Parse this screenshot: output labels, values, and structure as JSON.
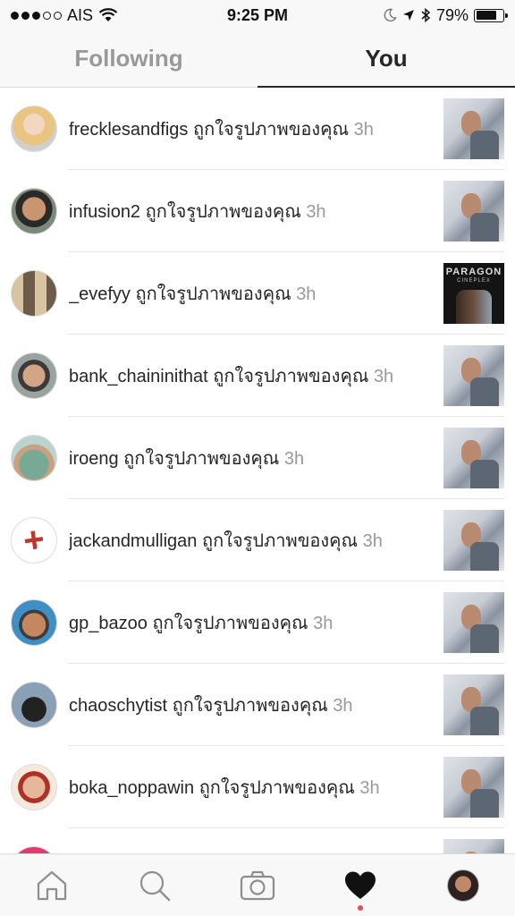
{
  "status_bar": {
    "carrier": "AIS",
    "time": "9:25 PM",
    "battery": "79%",
    "battery_level": 0.79,
    "signal_bars": 3,
    "icons": [
      "wifi-icon",
      "moon-icon",
      "location-arrow-icon",
      "bluetooth-icon",
      "battery-icon"
    ]
  },
  "tabs": [
    {
      "label": "Following",
      "active": false
    },
    {
      "label": "You",
      "active": true
    }
  ],
  "notifications": [
    {
      "username": "frecklesandfigs",
      "action": "ถูกใจรูปภาพของคุณ",
      "time": "3h",
      "thumb": "selfie-photo"
    },
    {
      "username": "infusion2",
      "action": "ถูกใจรูปภาพของคุณ",
      "time": "3h",
      "thumb": "selfie-photo"
    },
    {
      "username": "_evefyy",
      "action": "ถูกใจรูปภาพของคุณ",
      "time": "3h",
      "thumb": "cinema-photo"
    },
    {
      "username": "bank_chaininithat",
      "action": "ถูกใจรูปภาพของคุณ",
      "time": "3h",
      "thumb": "selfie-photo"
    },
    {
      "username": "iroeng",
      "action": "ถูกใจรูปภาพของคุณ",
      "time": "3h",
      "thumb": "selfie-photo"
    },
    {
      "username": "jackandmulligan",
      "action": "ถูกใจรูปภาพของคุณ",
      "time": "3h",
      "thumb": "selfie-photo"
    },
    {
      "username": "gp_bazoo",
      "action": "ถูกใจรูปภาพของคุณ",
      "time": "3h",
      "thumb": "selfie-photo"
    },
    {
      "username": "chaoschytist",
      "action": "ถูกใจรูปภาพของคุณ",
      "time": "3h",
      "thumb": "selfie-photo"
    },
    {
      "username": "boka_noppawin",
      "action": "ถูกใจรูปภาพของคุณ",
      "time": "3h",
      "thumb": "selfie-photo"
    }
  ],
  "cinema_thumb": {
    "title": "PARAGON",
    "subtitle": "CINEPLEX"
  },
  "bottom_nav": [
    {
      "icon": "home-icon",
      "active": false
    },
    {
      "icon": "search-icon",
      "active": false
    },
    {
      "icon": "camera-icon",
      "active": false
    },
    {
      "icon": "heart-icon",
      "active": true
    },
    {
      "icon": "profile-avatar",
      "active": false
    }
  ],
  "colors": {
    "accent_dot": "#ed4956",
    "muted_text": "#999999",
    "text": "#262626"
  }
}
